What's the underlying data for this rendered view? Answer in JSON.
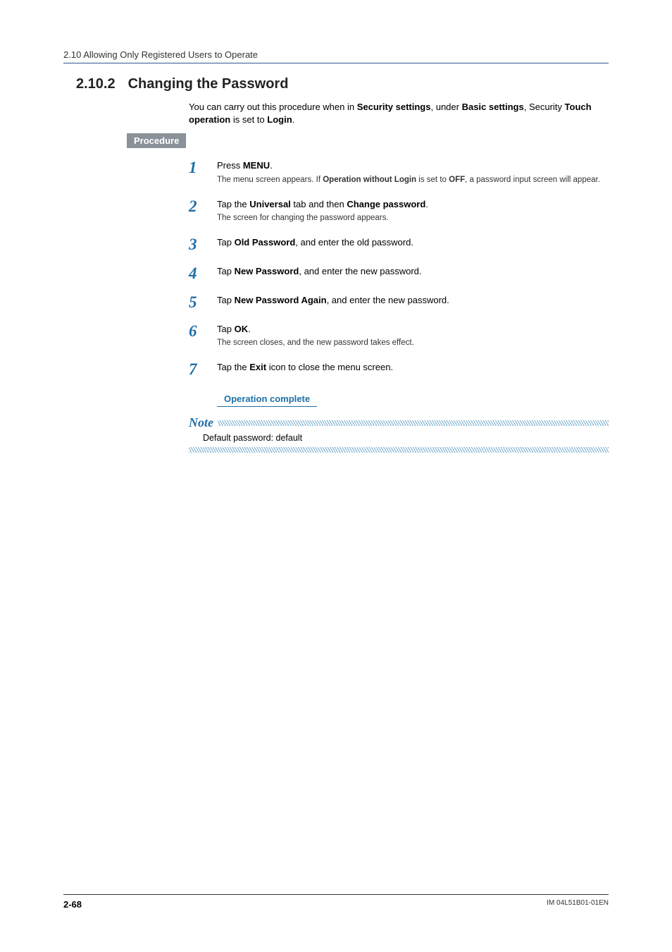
{
  "header": {
    "running_title": "2.10  Allowing Only Registered Users to Operate"
  },
  "section": {
    "number": "2.10.2",
    "title": "Changing the Password",
    "intro_pre": "You can carry out this procedure when in ",
    "intro_b1": "Security settings",
    "intro_mid1": ", under ",
    "intro_b2": "Basic settings",
    "intro_mid2": ", Security ",
    "intro_b3": "Touch operation",
    "intro_mid3": " is set to ",
    "intro_b4": "Login",
    "intro_end": "."
  },
  "procedure_label": "Procedure",
  "steps": [
    {
      "num": "1",
      "t1": "Press ",
      "b1": "MENU",
      "t2": ".",
      "sub_pre": "The menu screen appears. If ",
      "sub_b1": "Operation without Login",
      "sub_mid": " is set to ",
      "sub_b2": "OFF",
      "sub_end": ", a password input screen will appear."
    },
    {
      "num": "2",
      "t1": "Tap the ",
      "b1": "Universal",
      "t2": " tab and then ",
      "b2": "Change password",
      "t3": ".",
      "sub": "The screen for changing the password appears."
    },
    {
      "num": "3",
      "t1": "Tap ",
      "b1": "Old Password",
      "t2": ", and enter the old password."
    },
    {
      "num": "4",
      "t1": "Tap ",
      "b1": "New Password",
      "t2": ", and enter the new password."
    },
    {
      "num": "5",
      "t1": "Tap ",
      "b1": "New Password Again",
      "t2": ", and enter the new password."
    },
    {
      "num": "6",
      "t1": "Tap ",
      "b1": "OK",
      "t2": ".",
      "sub": "The screen closes, and the new password takes effect."
    },
    {
      "num": "7",
      "t1": "Tap the ",
      "b1": "Exit",
      "t2": " icon to close the menu screen."
    }
  ],
  "operation_complete": "Operation complete",
  "note": {
    "label": "Note",
    "body": "Default password: default"
  },
  "footer": {
    "page": "2-68",
    "doc_id": "IM 04L51B01-01EN"
  }
}
